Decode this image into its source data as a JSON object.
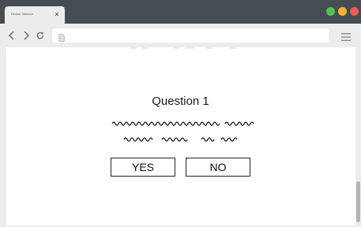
{
  "browser": {
    "tab": {
      "title": "Device Selector",
      "close_symbol": "×"
    },
    "window_buttons": [
      {
        "name": "green",
        "color": "#5bbd55"
      },
      {
        "name": "yellow",
        "color": "#f5b330"
      },
      {
        "name": "red",
        "color": "#ec5d57"
      }
    ],
    "toolbar": {
      "icons": [
        "back-arrow-icon",
        "forward-arrow-icon",
        "reload-icon",
        "page-icon",
        "hamburger-menu-icon"
      ],
      "address_value": ""
    }
  },
  "content": {
    "question_title": "Question 1",
    "buttons": {
      "yes_label": "YES",
      "no_label": "NO"
    }
  },
  "colors": {
    "titlebar": "#454d53",
    "toolbar": "#ececec",
    "text": "#1a1a1a"
  }
}
